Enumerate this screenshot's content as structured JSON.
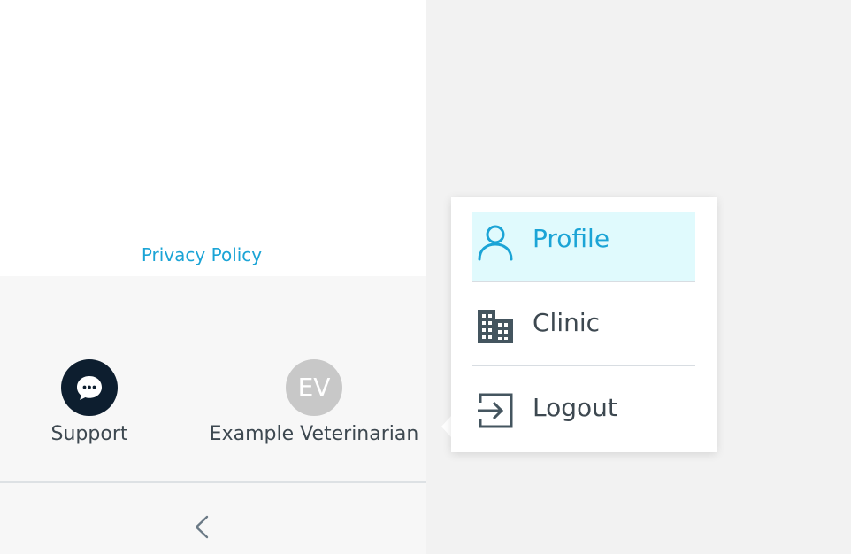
{
  "sidebar": {
    "privacy_link": "Privacy Policy",
    "support_label": "Support",
    "user": {
      "initials": "EV",
      "name": "Example Veterinarian"
    }
  },
  "icons": {
    "support": "chat-bubble-icon",
    "collapse": "chevron-left-icon",
    "profile": "user-icon",
    "clinic": "building-icon",
    "logout": "logout-icon"
  },
  "colors": {
    "accent": "#1ba4d6",
    "active_bg": "#e0fafd",
    "text": "#3d4850",
    "support_bg": "#0d1e2f",
    "avatar_bg": "#c8c8c8"
  },
  "user_menu": {
    "items": [
      {
        "label": "Profile",
        "active": true
      },
      {
        "label": "Clinic",
        "active": false
      },
      {
        "label": "Logout",
        "active": false
      }
    ]
  }
}
